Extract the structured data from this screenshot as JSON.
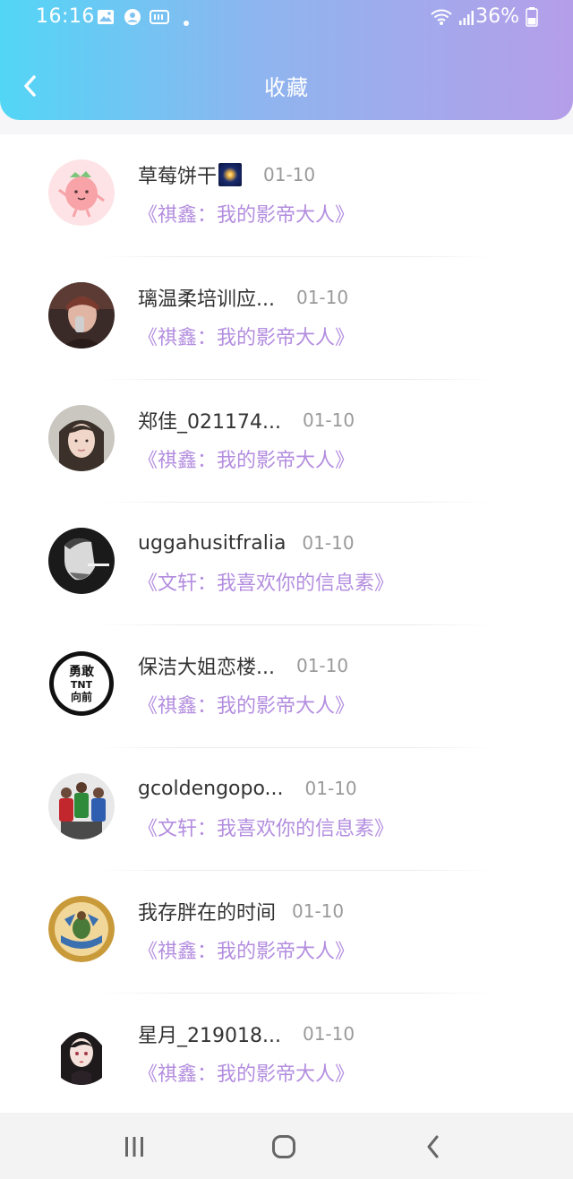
{
  "status_bar": {
    "time": "16:16",
    "battery": "36%"
  },
  "header": {
    "title": "收藏"
  },
  "favorites": [
    {
      "name": "草莓饼干",
      "date": "01-10",
      "book": "《祺鑫：我的影帝大人》"
    },
    {
      "name": "璃温柔培训应...",
      "date": "01-10",
      "book": "《祺鑫：我的影帝大人》"
    },
    {
      "name": "郑佳_021174...",
      "date": "01-10",
      "book": "《祺鑫：我的影帝大人》"
    },
    {
      "name": "uggahusitfralia",
      "date": "01-10",
      "book": "《文轩：我喜欢你的信息素》"
    },
    {
      "name": "保洁大姐恋楼...",
      "date": "01-10",
      "book": "《祺鑫：我的影帝大人》"
    },
    {
      "name": "gcoldengopo...",
      "date": "01-10",
      "book": "《文轩：我喜欢你的信息素》"
    },
    {
      "name": "我存胖在的时间",
      "date": "01-10",
      "book": "《祺鑫：我的影帝大人》"
    },
    {
      "name": "星月_219018...",
      "date": "01-10",
      "book": "《祺鑫：我的影帝大人》"
    }
  ],
  "avatar_text": {
    "badge_lines": [
      "勇敢",
      "TNT",
      "向前"
    ]
  },
  "colors": {
    "header_gradient": [
      "#52d6f6",
      "#8eb5ef",
      "#b59ee9"
    ],
    "book_title": "#b38ddf",
    "date": "#9a9a9a"
  }
}
